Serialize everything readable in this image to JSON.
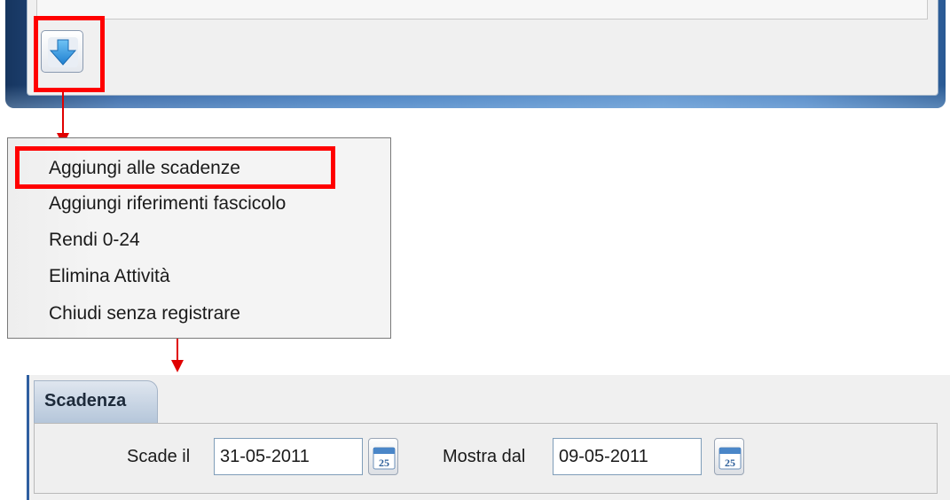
{
  "toolbar": {
    "download_button_icon": "arrow-down-icon"
  },
  "context_menu": {
    "items": [
      {
        "label": "Aggiungi alle scadenze"
      },
      {
        "label": "Aggiungi riferimenti fascicolo"
      },
      {
        "label": "Rendi 0-24"
      },
      {
        "label": "Elimina Attività"
      },
      {
        "label": "Chiudi senza registrare"
      }
    ]
  },
  "scadenza_panel": {
    "tab_label": "Scadenza",
    "scade_il_label": "Scade il",
    "scade_il_value": "31-05-2011",
    "mostra_dal_label": "Mostra dal",
    "mostra_dal_value": "09-05-2011",
    "calendar_icon_text": "25"
  },
  "colors": {
    "highlight": "#ff0000",
    "window_frame": "#3f79bd",
    "tab_bg": "#b5c6da"
  }
}
